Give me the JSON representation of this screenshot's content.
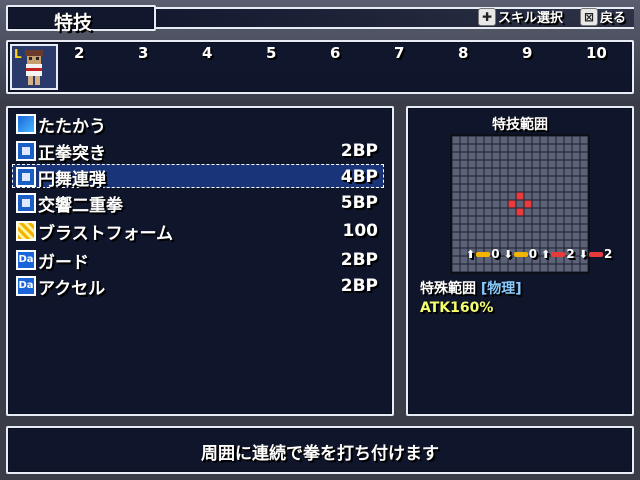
{
  "header": {
    "title": "特技",
    "hints": [
      {
        "key": "✚",
        "label": "スキル選択"
      },
      {
        "key": "⊠",
        "label": "戻る"
      }
    ]
  },
  "party": {
    "slot1_badge": "L",
    "slot_numbers": [
      "2",
      "3",
      "4",
      "5",
      "6",
      "7",
      "8",
      "9",
      "10"
    ]
  },
  "skills": [
    {
      "name": "たたかう",
      "cost": "",
      "icon": "sword-icon"
    },
    {
      "name": "正拳突き",
      "cost": "2BP",
      "icon": "blue-square-icon"
    },
    {
      "name": "円舞連弾",
      "cost": "4BP",
      "icon": "blue-square-icon",
      "selected": true
    },
    {
      "name": "交響二重拳",
      "cost": "5BP",
      "icon": "blue-square-icon"
    },
    {
      "name": "ブラストフォーム",
      "cost": "100",
      "icon": "gold-icon"
    },
    {
      "name": "ガード",
      "cost": "2BP",
      "icon": "da-icon"
    },
    {
      "name": "アクセル",
      "cost": "2BP",
      "icon": "da-icon"
    }
  ],
  "da_icon_text": "Da",
  "range": {
    "title": "特技範囲",
    "modifiers": [
      {
        "direction": "up",
        "value": "0",
        "color": "#f2b400"
      },
      {
        "direction": "down",
        "value": "0",
        "color": "#f2b400"
      },
      {
        "direction": "up",
        "value": "2",
        "color": "#e83a3a"
      },
      {
        "direction": "down",
        "value": "2",
        "color": "#e83a3a"
      }
    ],
    "label": "特殊範囲",
    "label_tag": "[物理]",
    "atk": "ATK160%"
  },
  "description": "周囲に連続で拳を打ち付けます",
  "colors": {
    "panel": "#0c1228",
    "border": "#e8ecf4",
    "cursor": "#285adc",
    "range_red": "#e83a3a"
  }
}
